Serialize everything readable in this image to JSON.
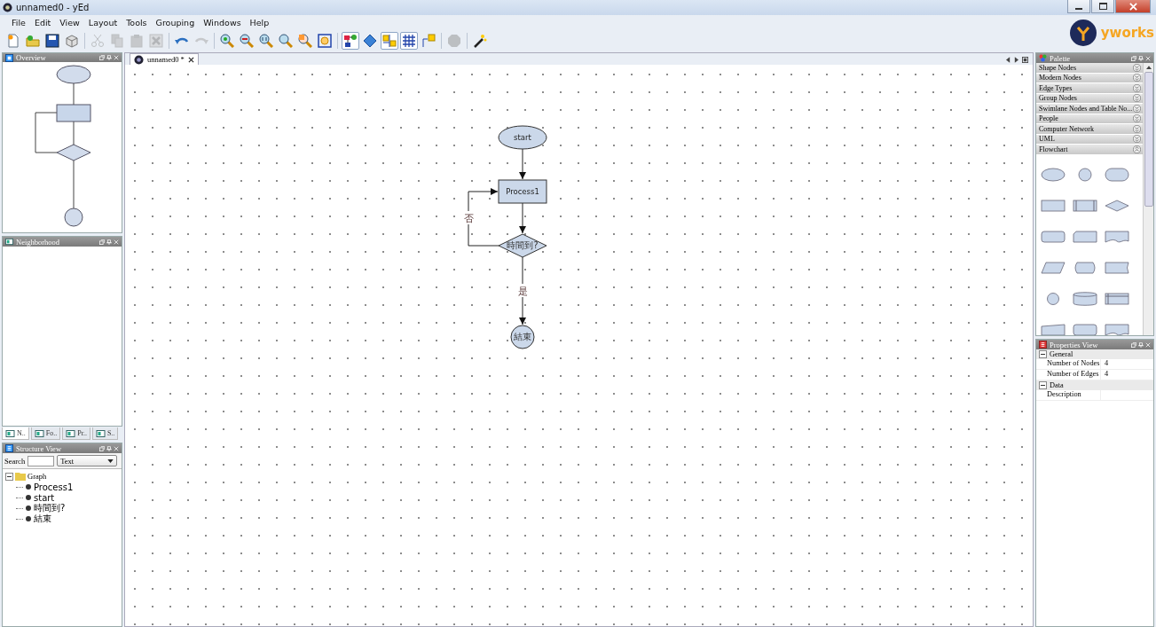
{
  "window": {
    "title": "unnamed0 - yEd"
  },
  "menu": [
    "File",
    "Edit",
    "View",
    "Layout",
    "Tools",
    "Grouping",
    "Windows",
    "Help"
  ],
  "toolbar": [
    {
      "kind": "new",
      "disabled": false,
      "pressed": false
    },
    {
      "kind": "open",
      "disabled": false,
      "pressed": false
    },
    {
      "kind": "save",
      "disabled": false,
      "pressed": false
    },
    {
      "kind": "cube",
      "disabled": false,
      "pressed": false
    },
    {
      "kind": "cut",
      "disabled": true,
      "pressed": false
    },
    {
      "kind": "copy",
      "disabled": true,
      "pressed": false
    },
    {
      "kind": "paste",
      "disabled": true,
      "pressed": false
    },
    {
      "kind": "delete",
      "disabled": true,
      "pressed": false
    },
    {
      "kind": "undo",
      "disabled": false,
      "pressed": false
    },
    {
      "kind": "redo",
      "disabled": true,
      "pressed": false
    },
    {
      "kind": "zoom-in",
      "disabled": false,
      "pressed": false
    },
    {
      "kind": "zoom-out",
      "disabled": false,
      "pressed": false
    },
    {
      "kind": "zoom-reset",
      "disabled": false,
      "pressed": false
    },
    {
      "kind": "zoom",
      "disabled": false,
      "pressed": false
    },
    {
      "kind": "zoom-selection",
      "disabled": false,
      "pressed": false
    },
    {
      "kind": "fit",
      "disabled": false,
      "pressed": false
    },
    {
      "kind": "nodes",
      "disabled": false,
      "pressed": true
    },
    {
      "kind": "diamond",
      "disabled": false,
      "pressed": false
    },
    {
      "kind": "snap",
      "disabled": false,
      "pressed": true
    },
    {
      "kind": "grid",
      "disabled": false,
      "pressed": true
    },
    {
      "kind": "label",
      "disabled": false,
      "pressed": false
    },
    {
      "kind": "blob",
      "disabled": true,
      "pressed": false
    },
    {
      "kind": "wand",
      "disabled": false,
      "pressed": false
    }
  ],
  "logo": {
    "text": "yworks"
  },
  "overview": {
    "title": "Overview"
  },
  "neighborhood": {
    "title": "Neighborhood"
  },
  "dock_tabs": [
    {
      "label": "N..",
      "selected": true
    },
    {
      "label": "Fo..",
      "selected": false
    },
    {
      "label": "Pr..",
      "selected": false
    },
    {
      "label": "S..",
      "selected": false
    }
  ],
  "structure_view": {
    "title": "Structure View",
    "search_label": "Search",
    "filter": "Text",
    "tree": [
      {
        "label": "Graph",
        "expanded": true,
        "children": [
          {
            "label": "Process1"
          },
          {
            "label": "start"
          },
          {
            "label": "時間到?"
          },
          {
            "label": "結束"
          }
        ]
      }
    ]
  },
  "document_tab": {
    "label": "unnamed0 *"
  },
  "diagram": {
    "nodes": [
      {
        "kind": "ellipse",
        "label": "start"
      },
      {
        "kind": "rectangle",
        "label": "Process1"
      },
      {
        "kind": "diamond",
        "label": "時間到?"
      },
      {
        "kind": "circle",
        "label": "結束"
      }
    ],
    "edge_labels": [
      "否",
      "是"
    ]
  },
  "palette": {
    "title": "Palette",
    "sections": [
      {
        "label": "Shape Nodes",
        "expanded": false
      },
      {
        "label": "Modern Nodes",
        "expanded": false
      },
      {
        "label": "Edge Types",
        "expanded": false
      },
      {
        "label": "Group Nodes",
        "expanded": false
      },
      {
        "label": "Swimlane Nodes and Table No...",
        "expanded": false
      },
      {
        "label": "People",
        "expanded": false
      },
      {
        "label": "Computer Network",
        "expanded": false
      },
      {
        "label": "UML",
        "expanded": false
      },
      {
        "label": "Flowchart",
        "expanded": true
      }
    ]
  },
  "properties": {
    "title": "Properties View",
    "groups": [
      {
        "label": "General",
        "expanded": true,
        "rows": [
          {
            "name": "Number of Nodes",
            "value": "4"
          },
          {
            "name": "Number of Edges",
            "value": "4"
          }
        ]
      },
      {
        "label": "Data",
        "expanded": true,
        "rows": [
          {
            "name": "Description"
          }
        ]
      }
    ]
  }
}
